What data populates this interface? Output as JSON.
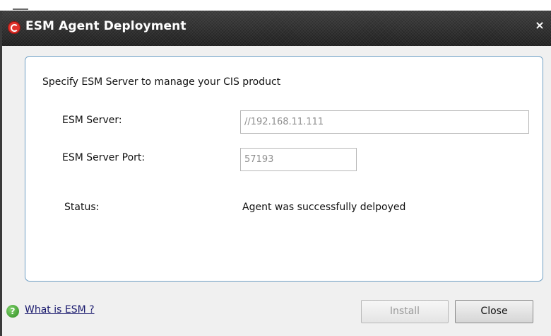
{
  "window": {
    "title": "ESM Agent Deployment",
    "close_glyph": "×",
    "app_icon": "comodo-c-icon"
  },
  "panel": {
    "heading": "Specify ESM Server to manage your CIS product",
    "server_label": "ESM Server:",
    "server_value": "//192.168.11.111",
    "port_label": "ESM Server Port:",
    "port_value": "57193",
    "status_label": "Status:",
    "status_value": "Agent was successfully delpoyed"
  },
  "footer": {
    "help_icon": "question-icon",
    "help_link": "What is ESM ?",
    "install_label": "Install",
    "close_label": "Close"
  },
  "colors": {
    "titlebar": "#2b2b2b",
    "panel_border": "#6f9fc4",
    "app_icon": "#e0322b",
    "help_icon": "#3a9a2c"
  }
}
